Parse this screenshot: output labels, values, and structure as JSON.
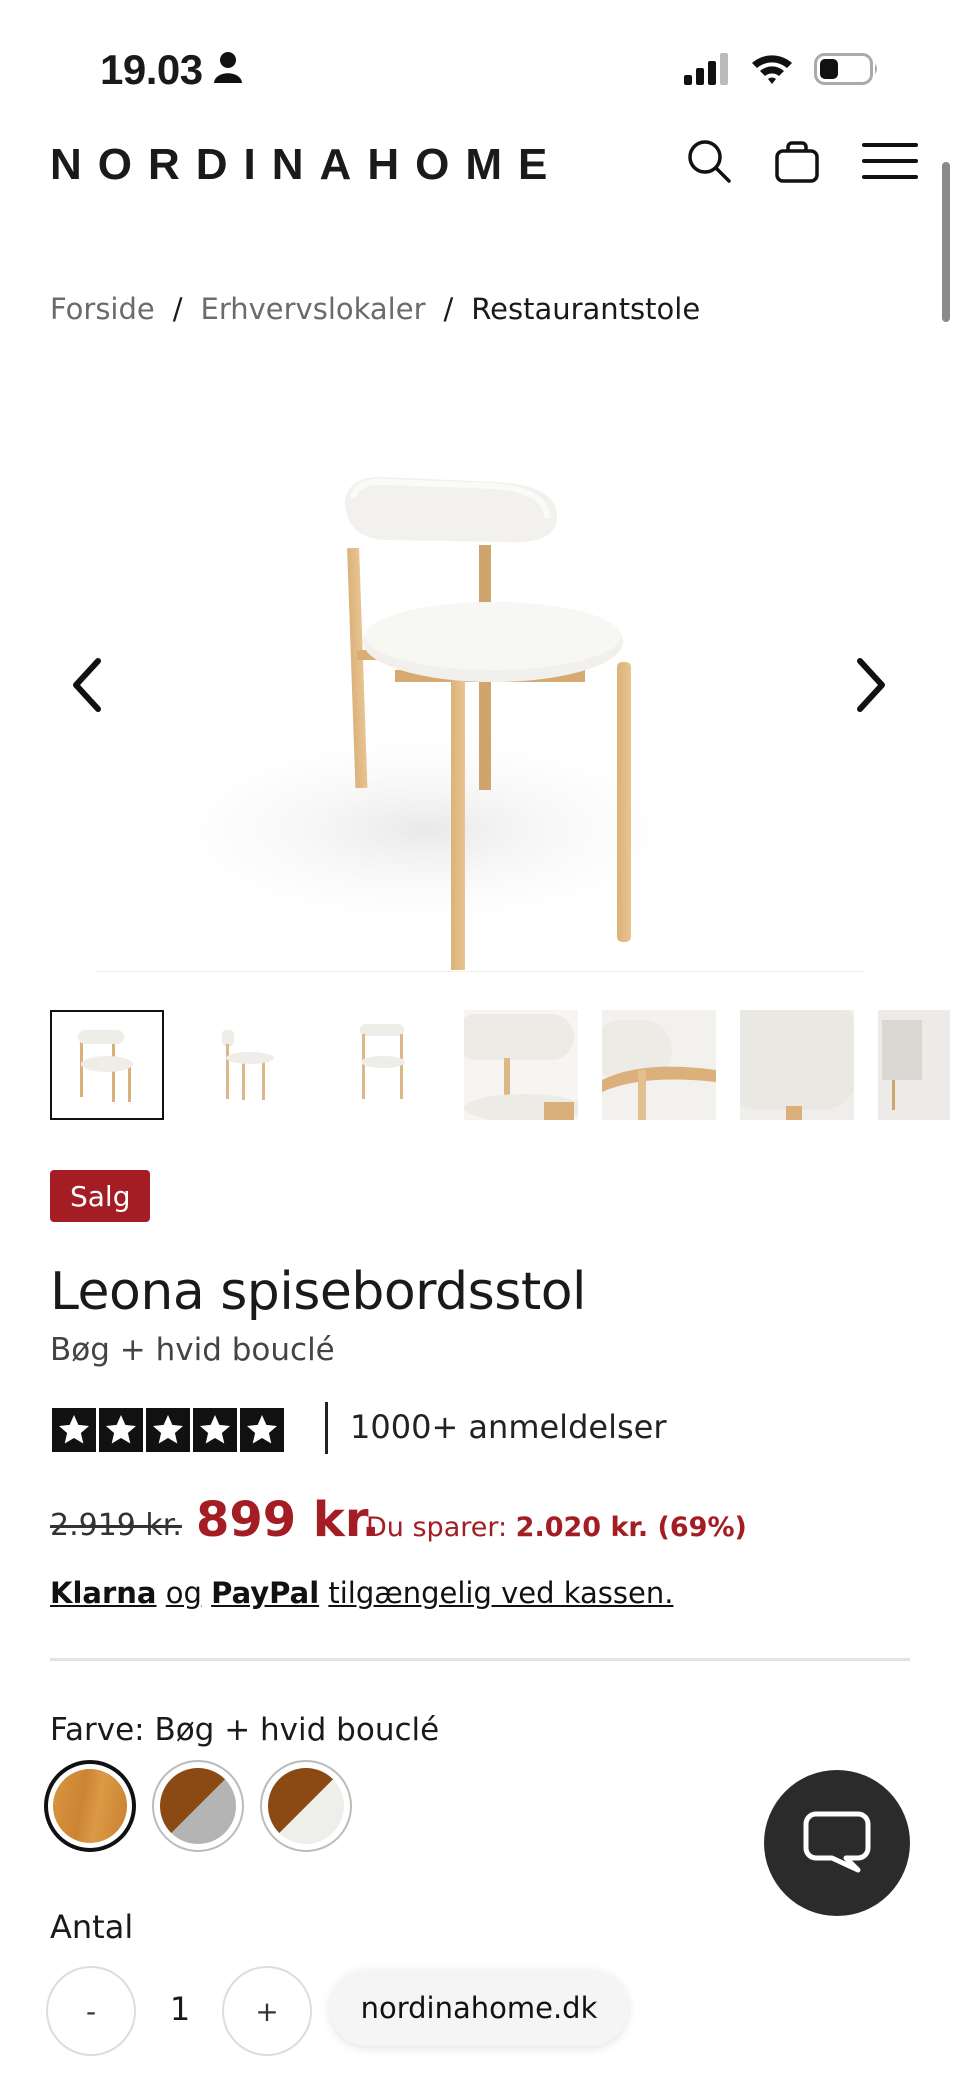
{
  "status_bar": {
    "time": "19.03",
    "user_icon": "person-icon",
    "signal_icon": "signal-icon",
    "wifi_icon": "wifi-icon",
    "battery_icon": "battery-icon"
  },
  "header": {
    "logo": "NORDINAHOME",
    "search_icon": "search-icon",
    "cart_icon": "bag-icon",
    "menu_icon": "menu-icon"
  },
  "breadcrumb": {
    "items": [
      "Forside",
      "Erhvervslokaler",
      "Restaurantstole"
    ],
    "separator": "/"
  },
  "gallery": {
    "prev_icon": "chevron-left-icon",
    "next_icon": "chevron-right-icon",
    "thumbnail_count": 7,
    "selected_index": 0
  },
  "product": {
    "badge": "Salg",
    "title": "Leona spisebordsstol",
    "subtitle": "Bøg + hvid bouclé",
    "rating_stars": 5,
    "reviews": "1000+ anmeldelser",
    "old_price": "2.919 kr.",
    "price": "899 kr.",
    "savings_label": "Du sparer:",
    "savings_value": "2.020 kr. (69%)",
    "payment": {
      "klarna": "Klarna",
      "og": "og",
      "paypal": "PayPal",
      "rest": "tilgængelig ved kassen."
    }
  },
  "color": {
    "label": "Farve: Bøg + hvid bouclé",
    "swatches": [
      {
        "name": "Bøg",
        "colors": [
          "#d38d3a",
          "#c47b2b"
        ]
      },
      {
        "name": "Valnød + grå",
        "colors": [
          "#8b4a13",
          "#b4b4b4"
        ]
      },
      {
        "name": "Valnød + hvid",
        "colors": [
          "#8b4a13",
          "#eeeeea"
        ]
      }
    ],
    "selected_index": 0
  },
  "quantity": {
    "label": "Antal",
    "minus": "-",
    "value": "1",
    "plus": "+"
  },
  "chat": {
    "icon": "chat-bubble-icon"
  },
  "browser": {
    "url": "nordinahome.dk"
  },
  "colors": {
    "sale_red": "#a41d24",
    "chat_bg": "#2b2b2b"
  }
}
